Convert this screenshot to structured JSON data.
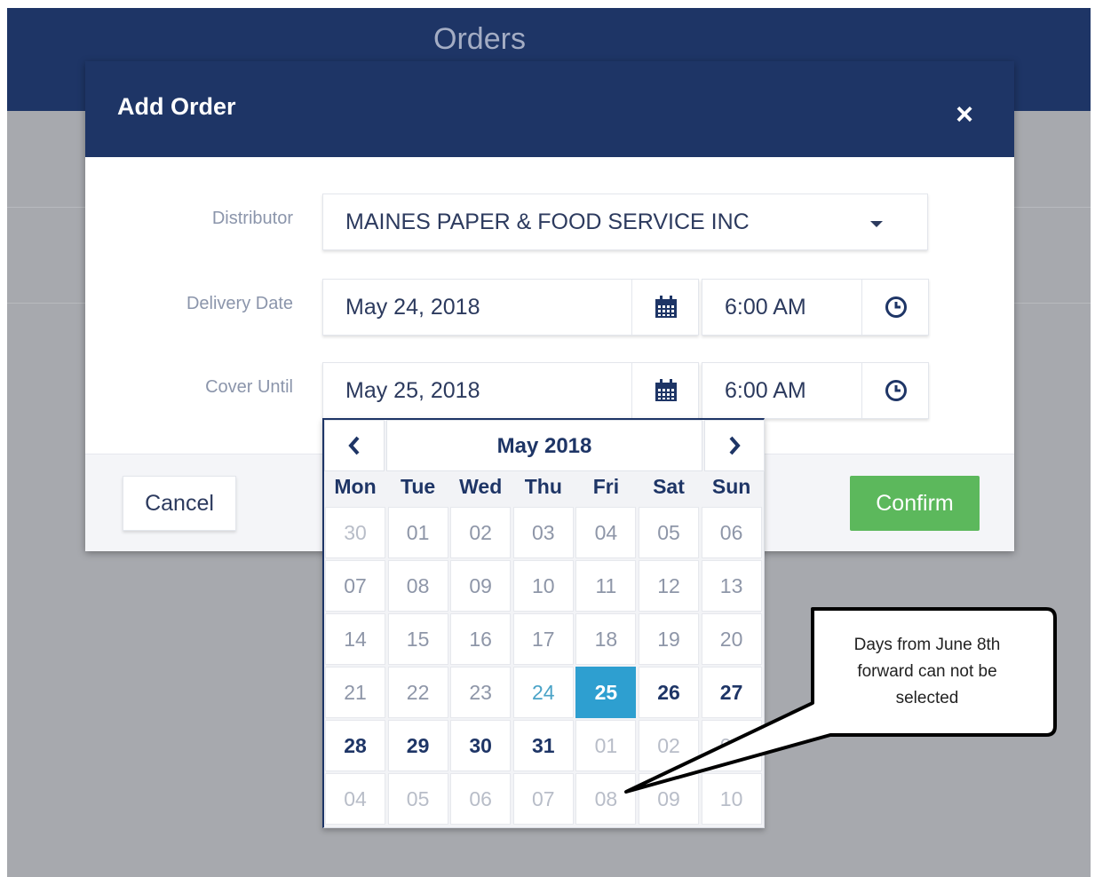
{
  "page": {
    "title": "Orders"
  },
  "modal": {
    "title": "Add Order",
    "close_icon": "×",
    "distributor": {
      "label": "Distributor",
      "value": "MAINES PAPER & FOOD SERVICE INC"
    },
    "delivery": {
      "label": "Delivery Date",
      "date": "May 24, 2018",
      "time": "6:00 AM"
    },
    "cover": {
      "label": "Cover Until",
      "date": "May 25, 2018",
      "time": "6:00 AM"
    },
    "cancel_label": "Cancel",
    "confirm_label": "Confirm"
  },
  "calendar": {
    "month_label": "May 2018",
    "prev_icon": "chevron-left-icon",
    "next_icon": "chevron-right-icon",
    "weekdays": [
      "Mon",
      "Tue",
      "Wed",
      "Thu",
      "Fri",
      "Sat",
      "Sun"
    ],
    "weeks": [
      [
        {
          "d": "30",
          "s": "faded"
        },
        {
          "d": "01",
          "s": "muted"
        },
        {
          "d": "02",
          "s": "muted"
        },
        {
          "d": "03",
          "s": "muted"
        },
        {
          "d": "04",
          "s": "muted"
        },
        {
          "d": "05",
          "s": "muted"
        },
        {
          "d": "06",
          "s": "muted"
        }
      ],
      [
        {
          "d": "07",
          "s": "muted"
        },
        {
          "d": "08",
          "s": "muted"
        },
        {
          "d": "09",
          "s": "muted"
        },
        {
          "d": "10",
          "s": "muted"
        },
        {
          "d": "11",
          "s": "muted"
        },
        {
          "d": "12",
          "s": "muted"
        },
        {
          "d": "13",
          "s": "muted"
        }
      ],
      [
        {
          "d": "14",
          "s": "muted"
        },
        {
          "d": "15",
          "s": "muted"
        },
        {
          "d": "16",
          "s": "muted"
        },
        {
          "d": "17",
          "s": "muted"
        },
        {
          "d": "18",
          "s": "muted"
        },
        {
          "d": "19",
          "s": "muted"
        },
        {
          "d": "20",
          "s": "muted"
        }
      ],
      [
        {
          "d": "21",
          "s": "muted"
        },
        {
          "d": "22",
          "s": "muted"
        },
        {
          "d": "23",
          "s": "muted"
        },
        {
          "d": "24",
          "s": "today"
        },
        {
          "d": "25",
          "s": "selected"
        },
        {
          "d": "26",
          "s": "active"
        },
        {
          "d": "27",
          "s": "active"
        }
      ],
      [
        {
          "d": "28",
          "s": "active"
        },
        {
          "d": "29",
          "s": "active"
        },
        {
          "d": "30",
          "s": "active"
        },
        {
          "d": "31",
          "s": "active"
        },
        {
          "d": "01",
          "s": "faded"
        },
        {
          "d": "02",
          "s": "faded"
        },
        {
          "d": "03",
          "s": "faded"
        }
      ],
      [
        {
          "d": "04",
          "s": "faded"
        },
        {
          "d": "05",
          "s": "faded"
        },
        {
          "d": "06",
          "s": "faded"
        },
        {
          "d": "07",
          "s": "faded"
        },
        {
          "d": "08",
          "s": "faded"
        },
        {
          "d": "09",
          "s": "faded"
        },
        {
          "d": "10",
          "s": "faded"
        }
      ]
    ]
  },
  "annotation": {
    "text": "Days from June 8th forward can not be selected"
  },
  "colors": {
    "navy": "#1e3566",
    "confirm_green": "#5cb85c",
    "selected_blue": "#2e9fd0"
  }
}
